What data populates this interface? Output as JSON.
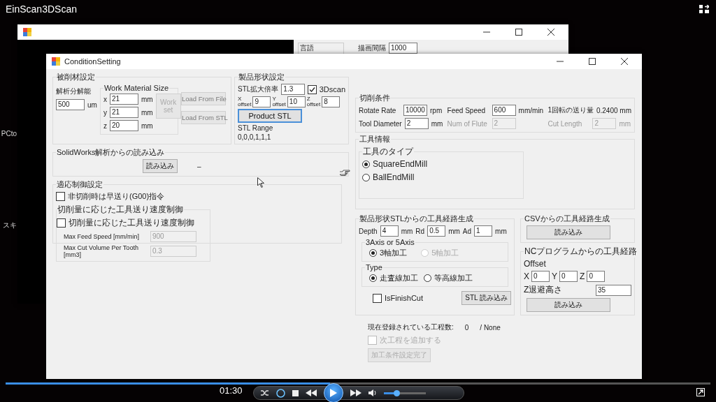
{
  "player": {
    "title": "EinScan3DScan",
    "time": "01:30",
    "seek": {
      "level": 0.46
    },
    "volume": {
      "level": 0.3
    }
  },
  "desktop_labels": [
    "PCto",
    "スキ"
  ],
  "back_window": {
    "language_label": "言語",
    "interval_label": "描画間隔",
    "interval_value": "1000"
  },
  "form": {
    "title": "ConditionSetting",
    "work_material": {
      "title": "被削材設定",
      "resolution_label": "解析分解能",
      "resolution": {
        "value": "500",
        "unit": "um"
      },
      "size_group": {
        "title": "Work Material Size",
        "rows": [
          {
            "label": "x",
            "value": "21",
            "unit": "mm"
          },
          {
            "label": "y",
            "value": "21",
            "unit": "mm"
          },
          {
            "label": "z",
            "value": "20",
            "unit": "mm"
          }
        ],
        "set_button": {
          "label": "Work set",
          "disabled": true
        }
      },
      "load_buttons": [
        {
          "label": "Load From File",
          "disabled": true
        },
        {
          "label": "Load From STL",
          "disabled": true
        }
      ]
    },
    "product_shape": {
      "title": "製品形状設定",
      "scale_label": "STL拡大倍率",
      "scale_value": "1.3",
      "scan_checkbox": {
        "label": "3Dscan",
        "checked": true,
        "disabled": false
      },
      "offsets": [
        {
          "axis": "X",
          "label": "offset",
          "value": "9"
        },
        {
          "axis": "Y",
          "label": "offset",
          "value": "10"
        },
        {
          "axis": "Z",
          "label": "offset",
          "value": "8"
        }
      ],
      "product_button": {
        "label": "Product STL",
        "disabled": false,
        "focused": true
      },
      "range_label": "STL Range",
      "range_value": "0,0,0,1,1,1"
    },
    "solidworks": {
      "title": "SolidWorks解析からの読み込み",
      "button": {
        "label": "読み込み",
        "disabled": false
      },
      "status": "–"
    },
    "adaptive": {
      "title": "適応制御設定",
      "rapid_checkbox": {
        "label": "非切削時は早送り(G00)指令",
        "checked": false,
        "disabled": false
      },
      "feed_group": {
        "title": "切削量に応じた工具送り速度制御",
        "checkbox": {
          "label": "切削量に応じた工具送り速度制御",
          "checked": false,
          "disabled": false
        },
        "params": [
          {
            "label": "Max Feed Speed [mm/min]",
            "value": "900",
            "disabled": true
          },
          {
            "label": "Max Cut Volume Per Tooth [mm3]",
            "value": "0.3",
            "disabled": true
          }
        ]
      }
    },
    "cutting": {
      "title": "切削条件",
      "rows": [
        [
          {
            "kind": "field",
            "label": "Rotate Rate",
            "value": "10000",
            "unit": "rpm",
            "disabled": false
          },
          {
            "kind": "field",
            "label": "Feed Speed",
            "value": "600",
            "unit": "mm/min",
            "disabled": false
          },
          {
            "kind": "readout",
            "label": "1回転の送り量",
            "value": "0.2400 mm"
          }
        ],
        [
          {
            "kind": "field",
            "label": "Tool Diameter",
            "value": "2",
            "unit": "mm",
            "disabled": false
          },
          {
            "kind": "field",
            "label": "Num of Flute",
            "value": "2",
            "disabled": true
          },
          {
            "kind": "field",
            "label": "Cut Length",
            "value": "2",
            "unit": "mm",
            "disabled": true
          }
        ]
      ]
    },
    "tool_info": {
      "title": "工具情報",
      "type_group": {
        "title": "工具のタイプ",
        "options": [
          {
            "label": "SquareEndMill",
            "selected": true,
            "disabled": false
          },
          {
            "label": "BallEndMill",
            "selected": false,
            "disabled": false
          }
        ]
      }
    },
    "stl_path": {
      "title": "製品形状STLからの工具経路生成",
      "params": [
        {
          "label": "Depth",
          "value": "4",
          "unit": "mm"
        },
        {
          "label": "Rd",
          "value": "0.5",
          "unit": "mm"
        },
        {
          "label": "Ad",
          "value": "1",
          "unit": "mm"
        }
      ],
      "axis_group": {
        "title": "3Axis or 5Axis",
        "options": [
          {
            "label": "3軸加工",
            "selected": true,
            "disabled": false
          },
          {
            "label": "5軸加工",
            "selected": false,
            "disabled": true
          }
        ]
      },
      "type_group": {
        "title": "Type",
        "options": [
          {
            "label": "走査線加工",
            "selected": true,
            "disabled": false
          },
          {
            "label": "等高線加工",
            "selected": false,
            "disabled": false
          }
        ]
      },
      "finish_checkbox": {
        "label": "IsFinishCut",
        "checked": false,
        "disabled": false
      },
      "load_button": {
        "label": "STL 読み込み",
        "disabled": false
      }
    },
    "csv": {
      "title": "CSVからの工具経路生成",
      "button": {
        "label": "読み込み",
        "disabled": false
      }
    },
    "nc": {
      "title": "NCプログラムからの工具経路",
      "offset_label": "Offset",
      "offsets": [
        {
          "axis": "X",
          "value": "0"
        },
        {
          "axis": "Y",
          "value": "0"
        },
        {
          "axis": "Z",
          "value": "0"
        }
      ],
      "retract_label": "Z退避高さ",
      "retract_value": "35",
      "button": {
        "label": "読み込み",
        "disabled": false
      }
    },
    "status": {
      "label": "現在登録されている工程数:",
      "count": "0",
      "name": "/ None",
      "next_checkbox": {
        "label": "次工程を追加する",
        "checked": false,
        "disabled": true
      },
      "finish_button": {
        "label": "加工条件設定完了",
        "disabled": true
      }
    }
  }
}
